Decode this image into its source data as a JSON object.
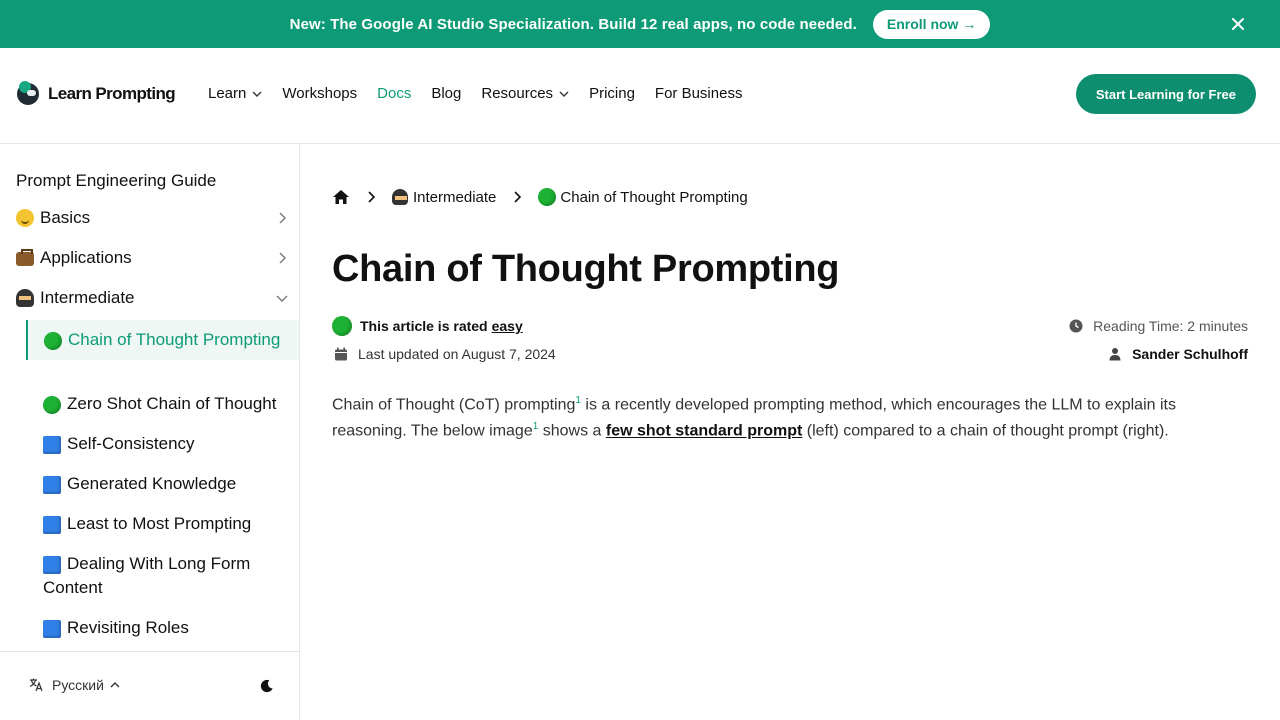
{
  "banner": {
    "text": "New: The Google AI Studio Specialization. Build 12 real apps, no code needed.",
    "cta": "Enroll now →"
  },
  "header": {
    "logo_text": "Learn Prompting",
    "nav": [
      {
        "label": "Learn",
        "dropdown": true
      },
      {
        "label": "Workshops",
        "dropdown": false
      },
      {
        "label": "Docs",
        "dropdown": false,
        "active": true
      },
      {
        "label": "Blog",
        "dropdown": false
      },
      {
        "label": "Resources",
        "dropdown": true
      },
      {
        "label": "Pricing",
        "dropdown": false
      },
      {
        "label": "For Business",
        "dropdown": false
      }
    ],
    "cta": "Start Learning for Free"
  },
  "sidebar": {
    "title": "Prompt Engineering Guide",
    "categories": [
      {
        "label": "Basics",
        "icon": "smile-icon"
      },
      {
        "label": "Applications",
        "icon": "briefcase-icon"
      },
      {
        "label": "Intermediate",
        "icon": "ninja-icon"
      }
    ],
    "items": [
      {
        "label": "Chain of Thought Prompting",
        "icon": "green-circle-icon"
      },
      {
        "label": "Zero Shot Chain of Thought",
        "icon": "green-circle-icon"
      },
      {
        "label": "Self-Consistency",
        "icon": "blue-square-icon"
      },
      {
        "label": "Generated Knowledge",
        "icon": "blue-square-icon"
      },
      {
        "label": "Least to Most Prompting",
        "icon": "blue-square-icon"
      },
      {
        "label": "Dealing With Long Form Content",
        "icon": "blue-square-icon"
      },
      {
        "label": "Revisiting Roles",
        "icon": "blue-square-icon"
      }
    ],
    "language": "Русский"
  },
  "main": {
    "breadcrumb": [
      "Intermediate",
      "Chain of Thought Prompting"
    ],
    "title": "Chain of Thought Prompting",
    "rating_prefix": "This article is rated",
    "rating": "easy",
    "reading_time": "Reading Time: 2 minutes",
    "updated": "Last updated on August 7, 2024",
    "author": "Sander Schulhoff",
    "body": {
      "p1": "Chain of Thought (CoT) prompting",
      "sup1": "1",
      "p2": " is a recently developed prompting method, which encourages the LLM to explain its reasoning. The below image",
      "sup2": "1",
      "p3": " shows a ",
      "link": "few shot standard prompt",
      "p4": " (left) compared to a chain of thought prompt (right)."
    }
  },
  "colors": {
    "accent": "#0d9b77",
    "banner": "#0d9b77",
    "cta": "#0d8f6f"
  }
}
